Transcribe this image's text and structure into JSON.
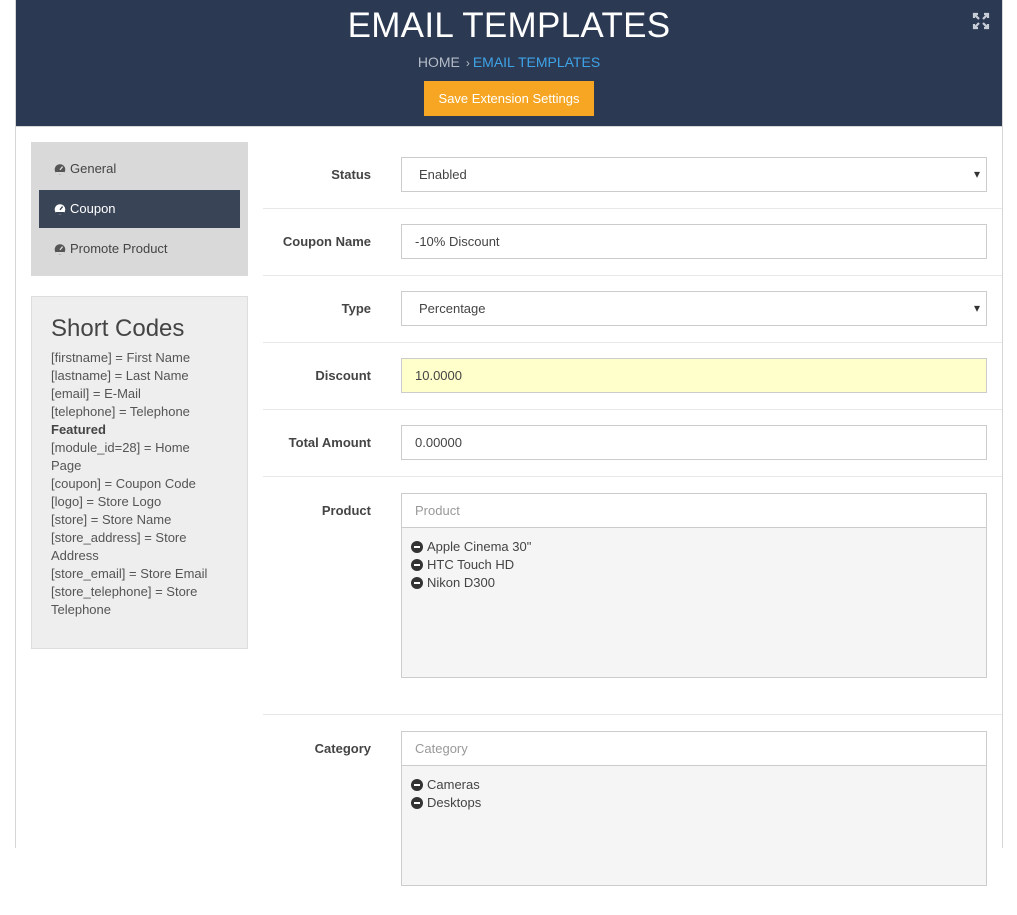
{
  "header": {
    "title": "EMAIL TEMPLATES",
    "breadcrumb": {
      "home": "HOME",
      "separator": "›",
      "current": "EMAIL TEMPLATES"
    },
    "save_button": "Save Extension Settings",
    "expand_icon": "expand-icon"
  },
  "nav": {
    "items": [
      {
        "label": "General",
        "icon": "dashboard-icon",
        "active": false
      },
      {
        "label": "Coupon",
        "icon": "dashboard-icon",
        "active": true
      },
      {
        "label": "Promote Product",
        "icon": "dashboard-icon",
        "active": false
      }
    ]
  },
  "shortcodes": {
    "title": "Short Codes",
    "lines": [
      "[firstname] = First Name",
      "[lastname] = Last Name",
      "[email] = E-Mail",
      "[telephone] = Telephone",
      "Featured",
      "[module_id=28] = Home",
      "Page",
      "[coupon] = Coupon Code",
      "[logo] = Store Logo",
      "[store] = Store Name",
      "[store_address] = Store",
      "Address",
      "[store_email] = Store Email",
      "[store_telephone] = Store",
      "Telephone"
    ]
  },
  "form": {
    "status": {
      "label": "Status",
      "value": "Enabled"
    },
    "coupon_name": {
      "label": "Coupon Name",
      "value": "-10% Discount"
    },
    "type": {
      "label": "Type",
      "value": "Percentage"
    },
    "discount": {
      "label": "Discount",
      "value": "10.0000"
    },
    "total_amount": {
      "label": "Total Amount",
      "value": "0.00000"
    },
    "product": {
      "label": "Product",
      "placeholder": "Product",
      "items": [
        "Apple Cinema 30\"",
        "HTC Touch HD",
        "Nikon D300"
      ]
    },
    "category": {
      "label": "Category",
      "placeholder": "Category",
      "items": [
        "Cameras",
        "Desktops"
      ]
    }
  },
  "colors": {
    "header_bg": "#2c3952",
    "accent": "#f6a623",
    "link": "#3ea3e8",
    "active_nav": "#3a4457",
    "highlight": "#ffffcc"
  }
}
